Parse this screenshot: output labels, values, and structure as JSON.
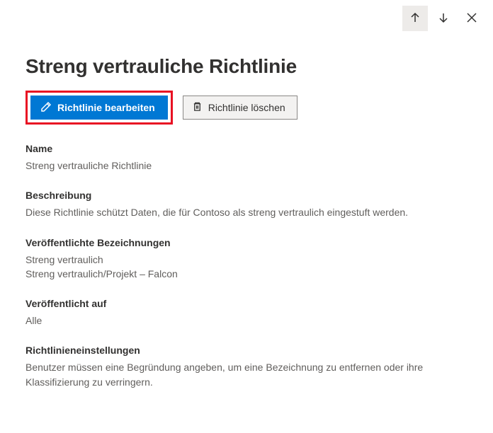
{
  "header": {
    "title": "Streng vertrauliche Richtlinie"
  },
  "actions": {
    "edit_label": "Richtlinie bearbeiten",
    "delete_label": "Richtlinie löschen"
  },
  "sections": {
    "name": {
      "label": "Name",
      "value": "Streng vertrauliche Richtlinie"
    },
    "description": {
      "label": "Beschreibung",
      "value": "Diese Richtlinie schützt Daten, die für Contoso als streng vertraulich eingestuft werden."
    },
    "published_labels": {
      "label": "Veröffentlichte Bezeichnungen",
      "values": [
        "Streng vertraulich",
        "Streng vertraulich/Projekt – Falcon"
      ]
    },
    "published_to": {
      "label": "Veröffentlicht auf",
      "value": "Alle"
    },
    "policy_settings": {
      "label": "Richtlinieneinstellungen",
      "value": "Benutzer müssen eine Begründung angeben, um eine Bezeichnung zu entfernen oder ihre Klassifizierung zu verringern."
    }
  }
}
